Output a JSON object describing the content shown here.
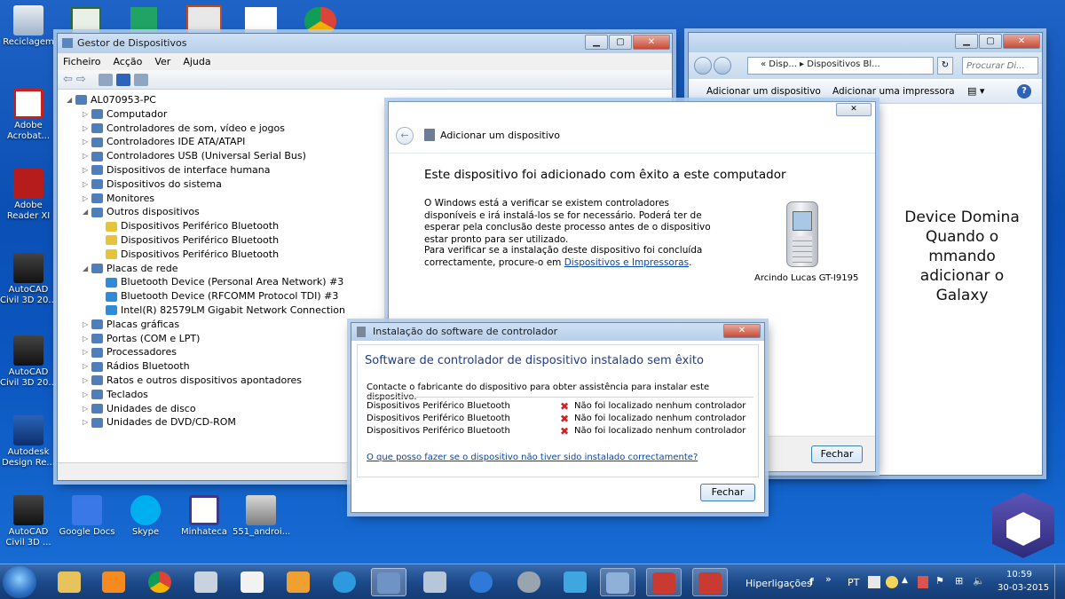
{
  "desktop": {
    "icons": [
      {
        "label": "Reciclagem"
      },
      {
        "label": "Adobe\nAcrobat..."
      },
      {
        "label": "Adobe\nReader XI"
      },
      {
        "label": "AutoCAD\nCivil 3D 20..."
      },
      {
        "label": "AutoCAD\nCivil 3D 20..."
      },
      {
        "label": "Autodesk\nDesign Re..."
      },
      {
        "label": "AutoCAD\nCivil 3D ..."
      },
      {
        "label": "Google Docs"
      },
      {
        "label": "Skype"
      },
      {
        "label": "Minhateca"
      },
      {
        "label": "551_androi..."
      }
    ],
    "note": "Device Domina\nQuando o\nmmando\nadicionar o\nGalaxy"
  },
  "device_manager": {
    "title": "Gestor de Dispositivos",
    "menu": [
      "Ficheiro",
      "Acção",
      "Ver",
      "Ajuda"
    ],
    "root": "AL070953-PC",
    "nodes": [
      {
        "label": "Computador",
        "level": 1,
        "exp": "▷"
      },
      {
        "label": "Controladores de som, vídeo e jogos",
        "level": 1,
        "exp": "▷"
      },
      {
        "label": "Controladores IDE ATA/ATAPI",
        "level": 1,
        "exp": "▷"
      },
      {
        "label": "Controladores USB (Universal Serial Bus)",
        "level": 1,
        "exp": "▷"
      },
      {
        "label": "Dispositivos de interface humana",
        "level": 1,
        "exp": "▷"
      },
      {
        "label": "Dispositivos do sistema",
        "level": 1,
        "exp": "▷"
      },
      {
        "label": "Monitores",
        "level": 1,
        "exp": "▷"
      },
      {
        "label": "Outros dispositivos",
        "level": 1,
        "exp": "◢"
      },
      {
        "label": "Dispositivos Periférico Bluetooth",
        "level": 2,
        "exp": "",
        "warn": true
      },
      {
        "label": "Dispositivos Periférico Bluetooth",
        "level": 2,
        "exp": "",
        "warn": true
      },
      {
        "label": "Dispositivos Periférico Bluetooth",
        "level": 2,
        "exp": "",
        "warn": true
      },
      {
        "label": "Placas de rede",
        "level": 1,
        "exp": "◢"
      },
      {
        "label": "Bluetooth Device (Personal Area Network) #3",
        "level": 2,
        "exp": "",
        "net": true
      },
      {
        "label": "Bluetooth Device (RFCOMM Protocol TDI) #3",
        "level": 2,
        "exp": "",
        "net": true
      },
      {
        "label": "Intel(R) 82579LM Gigabit Network Connection",
        "level": 2,
        "exp": "",
        "net": true
      },
      {
        "label": "Placas gráficas",
        "level": 1,
        "exp": "▷"
      },
      {
        "label": "Portas (COM e LPT)",
        "level": 1,
        "exp": "▷"
      },
      {
        "label": "Processadores",
        "level": 1,
        "exp": "▷"
      },
      {
        "label": "Rádios Bluetooth",
        "level": 1,
        "exp": "▷"
      },
      {
        "label": "Ratos e outros dispositivos apontadores",
        "level": 1,
        "exp": "▷"
      },
      {
        "label": "Teclados",
        "level": 1,
        "exp": "▷"
      },
      {
        "label": "Unidades de disco",
        "level": 1,
        "exp": "▷"
      },
      {
        "label": "Unidades de DVD/CD-ROM",
        "level": 1,
        "exp": "▷"
      }
    ]
  },
  "explorer": {
    "breadcrumb": "«  Disp...  ▸  Dispositivos Bl...",
    "search_placeholder": "Procurar Di...",
    "cmd_add_device": "Adicionar um dispositivo",
    "cmd_add_printer": "Adicionar uma impressora"
  },
  "add_device": {
    "title": "Adicionar um dispositivo",
    "heading": "Este dispositivo foi adicionado com êxito a este computador",
    "para1": "O Windows está a verificar se existem controladores disponíveis e irá instalá-los se for necessário. Poderá ter de esperar pela conclusão deste processo antes de o dispositivo estar pronto para ser utilizado.",
    "para2_pre": "Para verificar se a instalação deste dispositivo foi concluída correctamente, procure-o em ",
    "para2_link": "Dispositivos e Impressoras",
    "para2_post": ".",
    "device_name": "Arcindo Lucas GT-I9195",
    "close_button": "Fechar"
  },
  "driver_install": {
    "title": "Instalação do software de controlador",
    "heading": "Software de controlador de dispositivo instalado sem êxito",
    "message": "Contacte o fabricante do dispositivo para obter assistência para instalar este dispositivo.",
    "rows": [
      {
        "device": "Dispositivos Periférico Bluetooth",
        "status": "Não foi localizado nenhum controlador"
      },
      {
        "device": "Dispositivos Periférico Bluetooth",
        "status": "Não foi localizado nenhum controlador"
      },
      {
        "device": "Dispositivos Periférico Bluetooth",
        "status": "Não foi localizado nenhum controlador"
      }
    ],
    "help_link": "O que posso fazer se o dispositivo não tiver sido instalado correctamente?",
    "close_button": "Fechar"
  },
  "taskbar": {
    "links_label": "Hiperligações",
    "lang": "PT",
    "time": "10:59",
    "date": "30-03-2015"
  }
}
